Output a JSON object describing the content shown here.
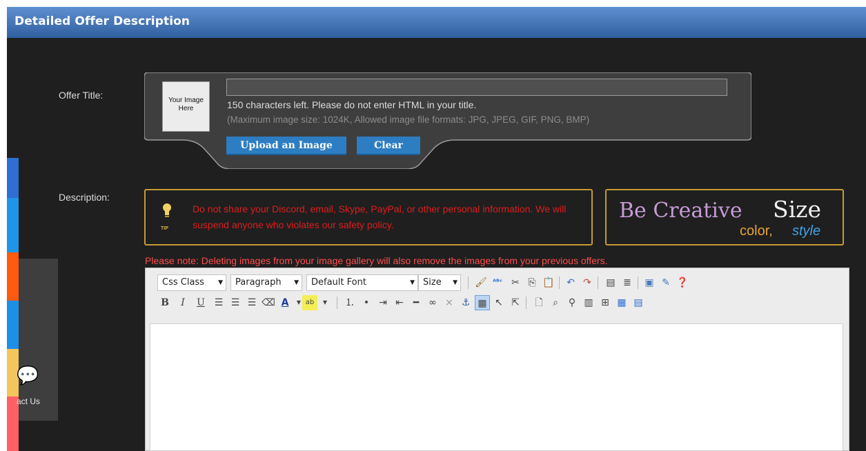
{
  "header": {
    "title": "Detailed Offer Description"
  },
  "offer_title": {
    "label": "Offer Title:",
    "image_placeholder": "Your Image Here",
    "input_value": "",
    "chars_left": "150  characters left. Please do not enter HTML in your title.",
    "image_note": "(Maximum image size: 1024K, Allowed image file formats: JPG, JPEG, GIF, PNG, BMP)",
    "upload_label": "Upload an Image",
    "clear_label": "Clear"
  },
  "description": {
    "label": "Description:",
    "tip_label": "TIP",
    "tip_text": "Do not share your Discord, email, Skype, PayPal, or other personal information. We will suspend anyone who violates our safety policy.",
    "creative": {
      "be_creative": "Be Creative",
      "size": "Size",
      "color": "color,",
      "style": "style"
    },
    "gallery_note": "Please note: Deleting images from your image gallery will also remove the images from your previous offers."
  },
  "toolbar": {
    "css_class": "Css Class",
    "paragraph": "Paragraph",
    "font": "Default Font",
    "size": "Size"
  },
  "sidebar": {
    "contact_label": "act Us",
    "colors": [
      "#2f6fd4",
      "#1e95e8",
      "#ff5a12",
      "#1e8fe6",
      "#f2c55d",
      "#ff6066"
    ]
  },
  "colors": {
    "header": "#3f6fb3",
    "accent_button": "#2d7dc2",
    "tip_border": "#c79a35",
    "warning_text": "#e01c1c"
  }
}
